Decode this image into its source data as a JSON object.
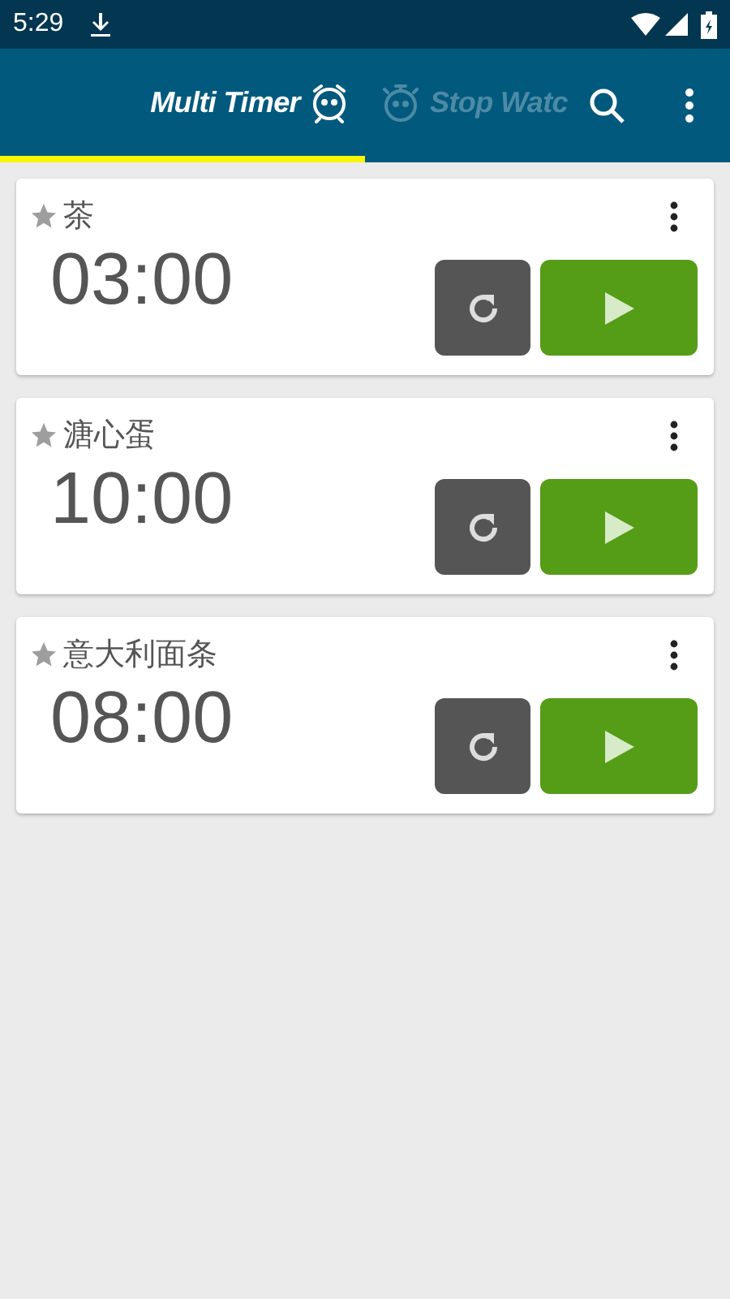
{
  "status_bar": {
    "time": "5:29"
  },
  "tabs": [
    {
      "label": "Multi Timer",
      "selected": true
    },
    {
      "label": "Stop Watc",
      "selected": false
    }
  ],
  "timers": [
    {
      "name": "茶",
      "time": "03:00"
    },
    {
      "name": "溏心蛋",
      "time": "10:00"
    },
    {
      "name": "意大利面条",
      "time": "08:00"
    }
  ]
}
